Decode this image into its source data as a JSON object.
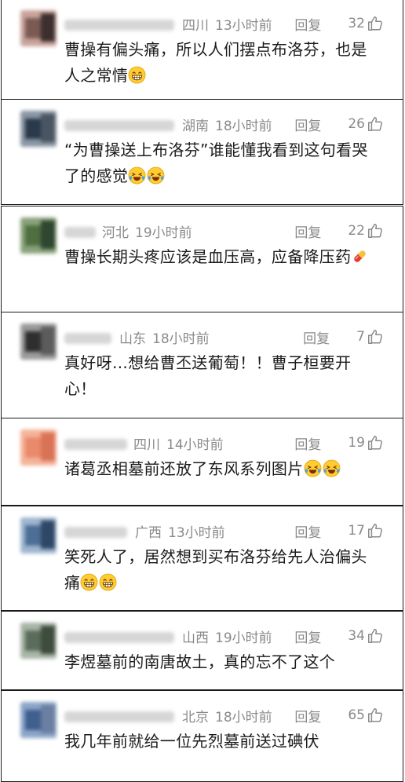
{
  "comments": [
    {
      "location": "四川",
      "time": "13小时前",
      "reply": "回复",
      "likes": "32",
      "text": "曹操有偏头痛，所以人们摆点布洛芬，也是人之常情",
      "emojis": [
        "grin"
      ]
    },
    {
      "location": "湖南",
      "time": "18小时前",
      "reply": "回复",
      "likes": "26",
      "text": "“为曹操送上布洛芬”谁能懂我看到这句看哭了的感觉",
      "emojis": [
        "tears",
        "tears"
      ]
    },
    {
      "location": "河北",
      "time": "19小时前",
      "reply": "回复",
      "likes": "22",
      "text": "曹操长期头疼应该是血压高，应备降压药",
      "emojis": [
        "pill"
      ]
    },
    {
      "location": "山东",
      "time": "18小时前",
      "reply": "回复",
      "likes": "7",
      "text": "真好呀…想给曹丕送葡萄！！曹子桓要开心！",
      "emojis": []
    },
    {
      "location": "四川",
      "time": "14小时前",
      "reply": "回复",
      "likes": "19",
      "text": "诸葛丞相墓前还放了东风系列图片",
      "emojis": [
        "tears",
        "tears"
      ]
    },
    {
      "location": "广西",
      "time": "13小时前",
      "reply": "回复",
      "likes": "17",
      "text": "笑死人了，居然想到买布洛芬给先人治偏头痛",
      "emojis": [
        "grin",
        "grin"
      ]
    },
    {
      "location": "山西",
      "time": "19小时前",
      "reply": "回复",
      "likes": "34",
      "text": "李煜墓前的南唐故土，真的忘不了这个",
      "emojis": []
    },
    {
      "location": "北京",
      "time": "18小时前",
      "reply": "回复",
      "likes": "65",
      "text": "我几年前就给一位先烈墓前送过碘伏",
      "emojis": []
    }
  ],
  "icons": {
    "like": "thumbs-up-icon",
    "grin": "grinning-face-emoji",
    "tears": "face-with-tears-of-joy-emoji",
    "pill": "pill-emoji"
  },
  "colors": {
    "meta_text": "#8a8a8a",
    "body_text": "#1b1b1b",
    "border": "#1a1a1a"
  }
}
